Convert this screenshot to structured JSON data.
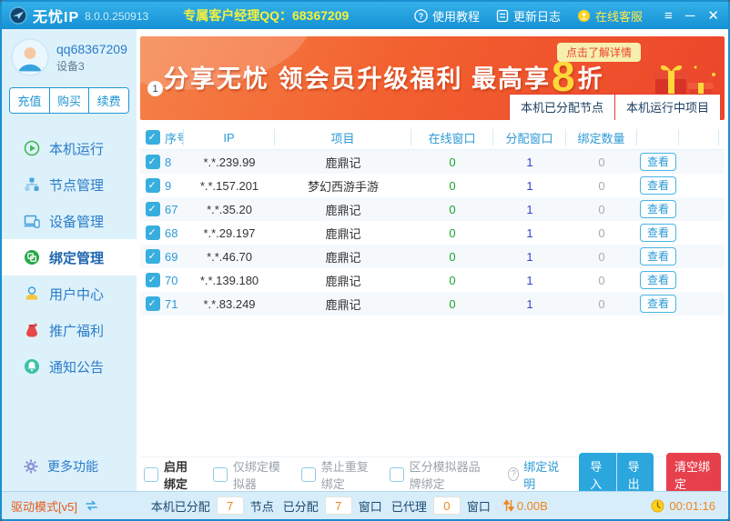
{
  "titlebar": {
    "app_title": "无忧IP",
    "version": "8.0.0.250913",
    "qq_label": "专属客户经理QQ：68367209",
    "tutorial": "使用教程",
    "changelog": "更新日志",
    "support": "在线客服",
    "menu_glyph": "≡",
    "minimize_glyph": "─",
    "close_glyph": "✕"
  },
  "sidebar": {
    "user": {
      "name": "qq68367209",
      "device": "设备3"
    },
    "account_buttons": [
      {
        "label": "充值"
      },
      {
        "label": "购买"
      },
      {
        "label": "续费"
      }
    ],
    "menu": [
      {
        "label": "本机运行"
      },
      {
        "label": "节点管理"
      },
      {
        "label": "设备管理"
      },
      {
        "label": "绑定管理"
      },
      {
        "label": "用户中心"
      },
      {
        "label": "推广福利"
      },
      {
        "label": "通知公告"
      }
    ],
    "more_label": "更多功能"
  },
  "banner": {
    "headline_prefix": "分享无忧 领会员升级福利 最高享",
    "headline_number": "8",
    "headline_suffix": "折",
    "badge": "点击了解详情",
    "page_indicator": "1"
  },
  "tabs": [
    {
      "label": "本机已分配节点"
    },
    {
      "label": "本机运行中项目"
    }
  ],
  "table": {
    "headers": {
      "seq": "序号",
      "ip": "IP",
      "project": "项目",
      "online": "在线窗口",
      "assigned": "分配窗口",
      "bound": "绑定数量"
    },
    "action_label": "查看",
    "rows": [
      {
        "seq": "8",
        "ip": "*.*.239.99",
        "project": "鹿鼎记",
        "online": "0",
        "assigned": "1",
        "bound": "0"
      },
      {
        "seq": "9",
        "ip": "*.*.157.201",
        "project": "梦幻西游手游",
        "online": "0",
        "assigned": "1",
        "bound": "0"
      },
      {
        "seq": "67",
        "ip": "*.*.35.20",
        "project": "鹿鼎记",
        "online": "0",
        "assigned": "1",
        "bound": "0"
      },
      {
        "seq": "68",
        "ip": "*.*.29.197",
        "project": "鹿鼎记",
        "online": "0",
        "assigned": "1",
        "bound": "0"
      },
      {
        "seq": "69",
        "ip": "*.*.46.70",
        "project": "鹿鼎记",
        "online": "0",
        "assigned": "1",
        "bound": "0"
      },
      {
        "seq": "70",
        "ip": "*.*.139.180",
        "project": "鹿鼎记",
        "online": "0",
        "assigned": "1",
        "bound": "0"
      },
      {
        "seq": "71",
        "ip": "*.*.83.249",
        "project": "鹿鼎记",
        "online": "0",
        "assigned": "1",
        "bound": "0"
      }
    ]
  },
  "controls": {
    "checkboxes": [
      {
        "label": "启用绑定"
      },
      {
        "label": "仅绑定模拟器"
      },
      {
        "label": "禁止重复绑定"
      },
      {
        "label": "区分模拟器品牌绑定"
      }
    ],
    "help_link": "绑定说明",
    "import_label": "导入",
    "export_label": "导出",
    "clear_label": "清空绑定"
  },
  "statusbar": {
    "driver_mode": "驱动模式[v5]",
    "assigned_label": "本机已分配",
    "assigned_value": "7",
    "node_label": "节点",
    "assigned2_label": "已分配",
    "assigned2_value": "7",
    "window_label": "窗口",
    "proxy_label": "已代理",
    "proxy_value": "0",
    "window2_label": "窗口",
    "traffic": "0.00B",
    "uptime": "00:01:16"
  },
  "colors": {
    "titlebar_blue": "#1f9ddb",
    "sidebar_bg": "#ddf1fb",
    "accent_blue": "#2e9ad6",
    "banner_orange": "#ee4b2e",
    "highlight_yellow": "#ffd83a",
    "danger_red": "#e7404d",
    "status_orange": "#f08519",
    "online_green": "#18a52c",
    "assigned_blue": "#3344cc"
  }
}
